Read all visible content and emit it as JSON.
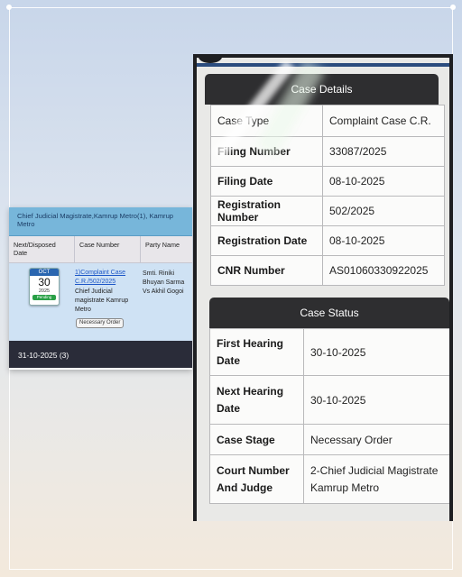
{
  "left_card": {
    "court_title": "Chief Judicial Magistrate,Kamrup Metro(1), Kamrup Metro",
    "columns": [
      "Next/Disposed Date",
      "Case Number",
      "Party Name"
    ],
    "row": {
      "calendar": {
        "month": "OCT",
        "day": "30",
        "year": "2025",
        "status": "Pending"
      },
      "case_number": "1)Complaint Case C.R./502/2025",
      "court": "Chief Judicial magistrate Kamrup Metro",
      "stage_badge": "Necessary Order",
      "party_name": "Smti. Riniki Bhuyan Sarma Vs Akhil Gogoi"
    },
    "footer_date": "31-10-2025 (3)"
  },
  "case_details": {
    "title": "Case Details",
    "rows": [
      {
        "label": "Case Type",
        "value": "Complaint Case C.R."
      },
      {
        "label": "Filing Number",
        "value": "33087/2025"
      },
      {
        "label": "Filing Date",
        "value": "08-10-2025"
      },
      {
        "label": "Registration Number",
        "value": "502/2025"
      },
      {
        "label": "Registration Date",
        "value": "08-10-2025"
      },
      {
        "label": "CNR Number",
        "value": "AS01060330922025"
      }
    ]
  },
  "case_status": {
    "title": "Case Status",
    "rows": [
      {
        "label": "First Hearing Date",
        "value": "30-10-2025"
      },
      {
        "label": "Next Hearing Date",
        "value": "30-10-2025"
      },
      {
        "label": "Case Stage",
        "value": "Necessary Order"
      },
      {
        "label": "Court Number And Judge",
        "value": "2-Chief Judicial Magistrate Kamrup Metro"
      }
    ]
  }
}
